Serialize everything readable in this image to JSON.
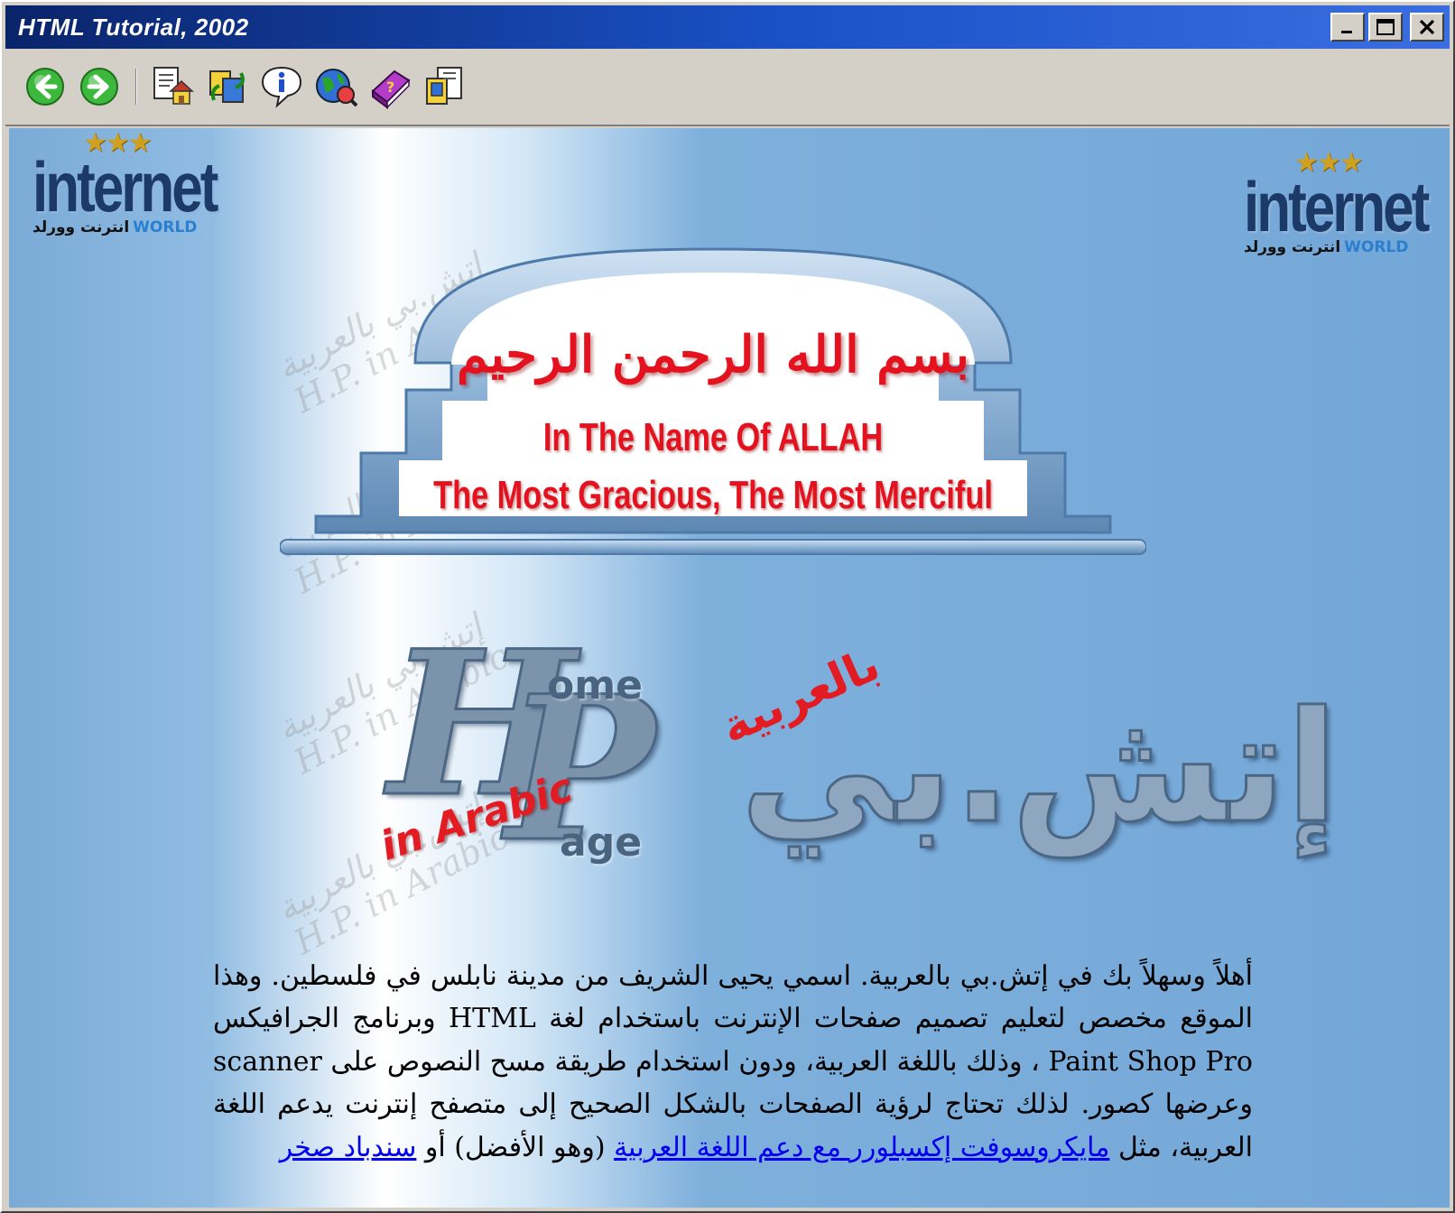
{
  "window": {
    "title": "HTML Tutorial, 2002",
    "controls": [
      "minimize",
      "maximize",
      "close"
    ]
  },
  "toolbar": {
    "buttons": [
      {
        "name": "back",
        "icon": "arrow-left-circle-icon",
        "color": "#2ca02c"
      },
      {
        "name": "forward",
        "icon": "arrow-right-circle-icon",
        "color": "#2ca02c"
      },
      {
        "name": "home",
        "icon": "home-page-icon"
      },
      {
        "name": "sync",
        "icon": "sync-icon"
      },
      {
        "name": "info",
        "icon": "info-icon"
      },
      {
        "name": "web",
        "icon": "globe-icon"
      },
      {
        "name": "help",
        "icon": "help-book-icon"
      },
      {
        "name": "print",
        "icon": "print-icon"
      }
    ]
  },
  "logos": {
    "left": {
      "stars": "★★★",
      "word": "internet",
      "sub_ar": "انترنت وورلد",
      "sub_en": "WORLD"
    },
    "right": {
      "stars": "★★★",
      "word": "internet",
      "sub_ar": "انترنت وورلد",
      "sub_en": "WORLD"
    }
  },
  "watermark": {
    "lines": [
      "إتش.بي بالعربية",
      "H.P. in Arabic"
    ]
  },
  "banner": {
    "basmala": "بسم الله الرحمن الرحيم",
    "line1": "In The Name Of ALLAH",
    "line2": "The Most Gracious, The Most Merciful",
    "text_color": "#e3121e",
    "frame_color": "#8fb3d6"
  },
  "hp_logo": {
    "h": "H",
    "p": "P",
    "ome": "ome",
    "age": "age",
    "in_arabic": "in Arabic",
    "arabic_title": "إتش.بي",
    "arabic_sub": "بالعربية"
  },
  "intro": {
    "sentences": [
      "أهلاً وسهلاً بك في إتش.بي بالعربية. اسمي يحيى الشريف من مدينة نابلس في فلسطين. وهذا الموقع مخصص لتعليم تصميم صفحات الإنترنت باستخدام لغة HTML وبرنامج الجرافيكس Paint Shop Pro ، وذلك باللغة العربية، ودون استخدام طريقة مسح النصوص على scanner وعرضها كصور. لذلك تحتاج لرؤية الصفحات بالشكل الصحيح إلى متصفح إنترنت يدعم اللغة العربية، مثل "
    ],
    "link1": "مايكروسوفت إكسبلورر مع دعم اللغة العربية",
    "middle": " (وهو الأفضل) أو ",
    "link2": "سندباد صخر",
    "link_color": "#0000ee"
  },
  "colors": {
    "titlebar_start": "#0a246a",
    "titlebar_end": "#3a6ee0",
    "page_blue": "#73a7d7"
  }
}
